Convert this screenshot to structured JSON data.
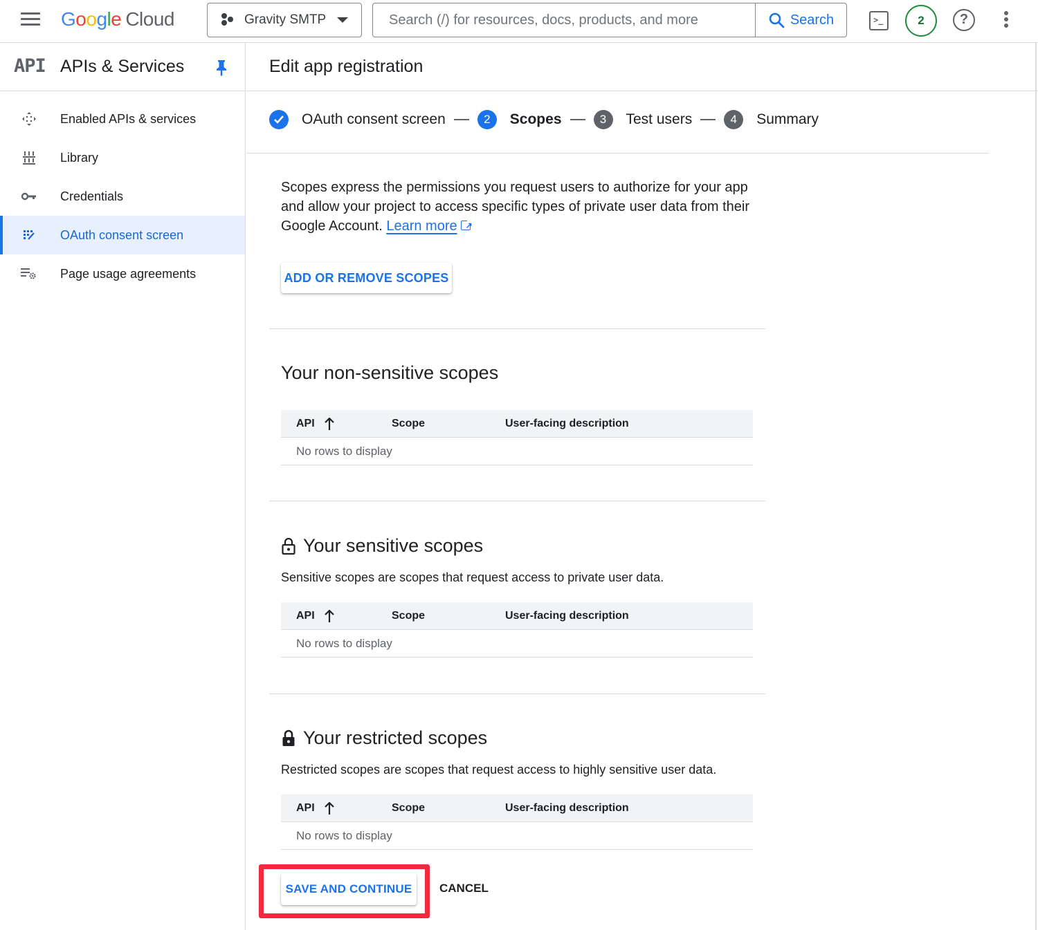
{
  "topbar": {
    "logo_letters": [
      "G",
      "o",
      "o",
      "g",
      "l",
      "e"
    ],
    "logo_product": "Cloud",
    "project_name": "Gravity SMTP",
    "search_placeholder": "Search (/) for resources, docs, products, and more",
    "search_button": "Search",
    "notification_count": "2",
    "help_glyph": "?",
    "terminal_glyph": ">_"
  },
  "sidebar": {
    "logo_text": "API",
    "title": "APIs & Services",
    "items": [
      {
        "label": "Enabled APIs & services",
        "icon": "enabled-apis-icon",
        "active": false
      },
      {
        "label": "Library",
        "icon": "library-icon",
        "active": false
      },
      {
        "label": "Credentials",
        "icon": "key-icon",
        "active": false
      },
      {
        "label": "OAuth consent screen",
        "icon": "oauth-consent-icon",
        "active": true
      },
      {
        "label": "Page usage agreements",
        "icon": "settings-list-icon",
        "active": false
      }
    ]
  },
  "main": {
    "title": "Edit app registration",
    "steps": [
      {
        "number": "✓",
        "label": "OAuth consent screen",
        "state": "done"
      },
      {
        "number": "2",
        "label": "Scopes",
        "state": "current"
      },
      {
        "number": "3",
        "label": "Test users",
        "state": "todo"
      },
      {
        "number": "4",
        "label": "Summary",
        "state": "todo"
      }
    ],
    "intro_text": "Scopes express the permissions you request users to authorize for your app and allow your project to access specific types of private user data from their Google Account.",
    "learn_more": "Learn more",
    "add_remove_button": "ADD OR REMOVE SCOPES",
    "table_headers": {
      "api": "API",
      "scope": "Scope",
      "description": "User-facing description"
    },
    "empty_text": "No rows to display",
    "sections": [
      {
        "title": "Your non-sensitive scopes",
        "description": "",
        "icon": "none"
      },
      {
        "title": "Your sensitive scopes",
        "description": "Sensitive scopes are scopes that request access to private user data.",
        "icon": "lock-open-outline"
      },
      {
        "title": "Your restricted scopes",
        "description": "Restricted scopes are scopes that request access to highly sensitive user data.",
        "icon": "lock-filled"
      }
    ],
    "save_button": "SAVE AND CONTINUE",
    "cancel_button": "CANCEL"
  },
  "colors": {
    "accent": "#1a73e8",
    "highlight": "#f2293f",
    "active_nav_bg": "#e8f0fe",
    "notification_green": "#1e8e3e"
  }
}
